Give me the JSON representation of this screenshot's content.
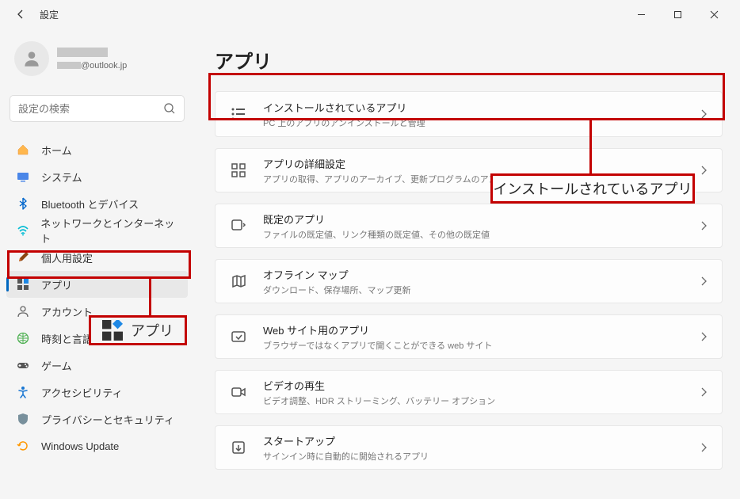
{
  "window": {
    "title": "設定"
  },
  "user": {
    "email_domain": "@outlook.jp"
  },
  "search": {
    "placeholder": "設定の検索"
  },
  "sidebar": {
    "items": [
      {
        "label": "ホーム",
        "icon": "home"
      },
      {
        "label": "システム",
        "icon": "system"
      },
      {
        "label": "Bluetooth とデバイス",
        "icon": "bluetooth"
      },
      {
        "label": "ネットワークとインターネット",
        "icon": "network"
      },
      {
        "label": "個人用設定",
        "icon": "personalize"
      },
      {
        "label": "アプリ",
        "icon": "apps"
      },
      {
        "label": "アカウント",
        "icon": "account"
      },
      {
        "label": "時刻と言語",
        "icon": "time"
      },
      {
        "label": "ゲーム",
        "icon": "game"
      },
      {
        "label": "アクセシビリティ",
        "icon": "accessibility"
      },
      {
        "label": "プライバシーとセキュリティ",
        "icon": "privacy"
      },
      {
        "label": "Windows Update",
        "icon": "update"
      }
    ]
  },
  "page": {
    "title": "アプリ"
  },
  "cards": [
    {
      "title": "インストールされているアプリ",
      "desc": "PC 上のアプリのアンインストールと管理"
    },
    {
      "title": "アプリの詳細設定",
      "desc": "アプリの取得、アプリのアーカイブ、更新プログラムのアンインストールを行う場所を選択します"
    },
    {
      "title": "既定のアプリ",
      "desc": "ファイルの既定値、リンク種類の既定値、その他の既定値"
    },
    {
      "title": "オフライン マップ",
      "desc": "ダウンロード、保存場所、マップ更新"
    },
    {
      "title": "Web サイト用のアプリ",
      "desc": "ブラウザーではなくアプリで開くことができる web サイト"
    },
    {
      "title": "ビデオの再生",
      "desc": "ビデオ調整、HDR ストリーミング、バッテリー オプション"
    },
    {
      "title": "スタートアップ",
      "desc": "サインイン時に自動的に開始されるアプリ"
    }
  ],
  "callouts": {
    "apps_label": "アプリ",
    "installed_label": "インストールされているアプリ"
  }
}
